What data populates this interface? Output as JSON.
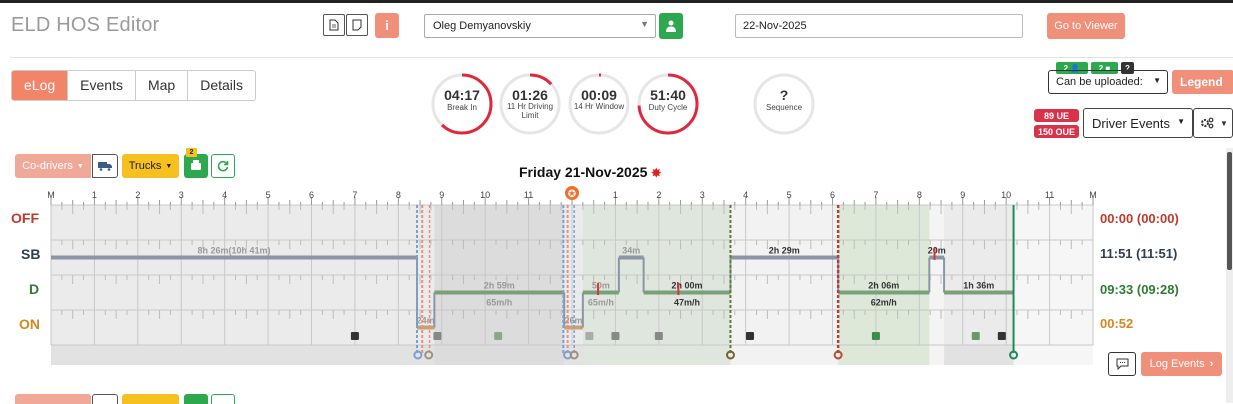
{
  "app": {
    "title": "ELD HOS Editor"
  },
  "header": {
    "driver": "Oleg Demyanovskiy",
    "date": "22-Nov-2025",
    "viewer_button": "Go to Viewer",
    "info_icon": "i"
  },
  "tabs": [
    "eLog",
    "Events",
    "Map",
    "Details"
  ],
  "gauges": [
    {
      "value": "04:17",
      "label": "Break In",
      "fraction": 0.62
    },
    {
      "value": "01:26",
      "label": "11 Hr Driving Limit",
      "fraction": 0.13
    },
    {
      "value": "00:09",
      "label": "14 Hr Window",
      "fraction": 0.01
    },
    {
      "value": "51:40",
      "label": "Duty Cycle",
      "fraction": 0.74
    },
    {
      "value": "?",
      "label": "Sequence",
      "fraction": 0
    }
  ],
  "upload": {
    "label": "Can be uploaded:",
    "pill1": "2",
    "pill2": "2",
    "pill3": "?"
  },
  "legend_button": "Legend",
  "badges": {
    "ue": "89 UE",
    "oue": "150 OUE"
  },
  "driver_events_select": "Driver Events",
  "codrivers_button": "Co-drivers",
  "trucks_button": "Trucks",
  "eld_badge": "2",
  "day_title": "Friday 21-Nov-2025",
  "colors": {
    "accent": "#f2846a",
    "green": "#2ea84f",
    "yellow": "#f5c020",
    "off": "#c0392b",
    "sb": "#2c3e50",
    "d": "#2e7d32",
    "on": "#d4881f"
  },
  "chart_data": {
    "type": "timeline",
    "x_tick_labels": [
      "M",
      "1",
      "2",
      "3",
      "4",
      "5",
      "6",
      "7",
      "8",
      "9",
      "10",
      "11",
      "",
      "1",
      "2",
      "3",
      "4",
      "5",
      "6",
      "7",
      "8",
      "9",
      "10",
      "11",
      "M"
    ],
    "rows": [
      {
        "label": "OFF",
        "total": "00:00 (00:00)"
      },
      {
        "label": "SB",
        "total": "11:51 (11:51)"
      },
      {
        "label": "D",
        "total": "09:33 (09:28)"
      },
      {
        "label": "ON",
        "total": "00:52"
      }
    ],
    "segments": [
      {
        "status": "SB",
        "start_h": 0.0,
        "end_h": 8.43,
        "label": "8h 26m(10h 41m)"
      },
      {
        "status": "ON",
        "start_h": 8.43,
        "end_h": 8.83,
        "label": "24m"
      },
      {
        "status": "D",
        "start_h": 8.83,
        "end_h": 11.82,
        "label": "2h 59m",
        "speed": "65m/h"
      },
      {
        "status": "ON",
        "start_h": 11.82,
        "end_h": 12.25,
        "label": "26m"
      },
      {
        "status": "D",
        "start_h": 12.25,
        "end_h": 13.08,
        "label": "50m",
        "speed": "65m/h"
      },
      {
        "status": "SB",
        "start_h": 13.08,
        "end_h": 13.65,
        "label": "34m"
      },
      {
        "status": "D",
        "start_h": 13.65,
        "end_h": 15.65,
        "label": "2h 00m",
        "speed": "47m/h"
      },
      {
        "status": "SB",
        "start_h": 15.65,
        "end_h": 18.13,
        "label": "2h 29m"
      },
      {
        "status": "D",
        "start_h": 18.13,
        "end_h": 20.23,
        "label": "2h 06m",
        "speed": "62m/h"
      },
      {
        "status": "SB",
        "start_h": 20.23,
        "end_h": 20.57,
        "label": "20m"
      },
      {
        "status": "D",
        "start_h": 20.57,
        "end_h": 22.17,
        "label": "1h 36m"
      }
    ]
  },
  "log_events_button": "Log Events"
}
